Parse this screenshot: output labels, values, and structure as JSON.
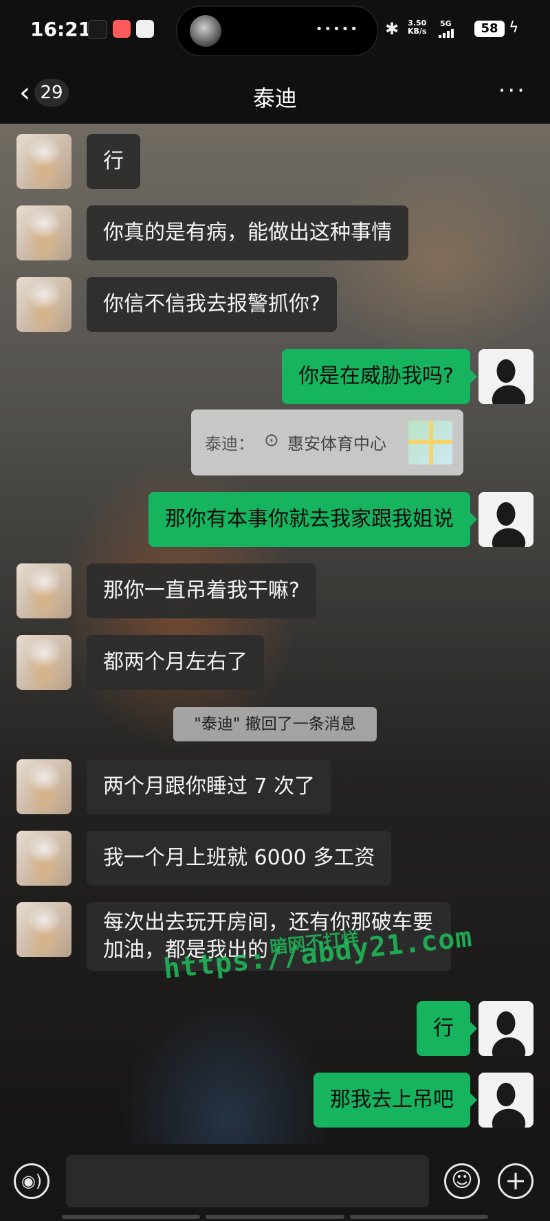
{
  "status_bar": {
    "time": "16:21",
    "net_speed_value": "3.50",
    "net_speed_unit": "KB/s",
    "network": "5G",
    "battery": "58",
    "bluetooth_icon": "bluetooth-icon",
    "charging_icon": "charging-bolt-icon"
  },
  "nav": {
    "back_icon": "chevron-left-icon",
    "unread_count": "29",
    "title": "泰迪",
    "more_icon": "more-dots-icon"
  },
  "messages": [
    {
      "side": "in",
      "text": "行"
    },
    {
      "side": "in",
      "text": "你真的是有病，能做出这种事情"
    },
    {
      "side": "in",
      "text": "你信不信我去报警抓你?"
    },
    {
      "side": "out",
      "text": "你是在威胁我吗?"
    },
    {
      "side": "out",
      "text": "那你有本事你就去我家跟我姐说"
    },
    {
      "side": "in",
      "text": "那你一直吊着我干嘛?"
    },
    {
      "side": "in",
      "text": "都两个月左右了"
    },
    {
      "side": "in",
      "text": "两个月跟你睡过 7 次了"
    },
    {
      "side": "in",
      "text": "我一个月上班就 6000 多工资"
    },
    {
      "side": "in",
      "text": "每次出去玩开房间，还有你那破车要加油，都是我出的"
    },
    {
      "side": "out",
      "text": "行"
    },
    {
      "side": "out",
      "text": "那我去上吊吧"
    }
  ],
  "location_share": {
    "sender": "泰迪：",
    "pin_icon": "location-pin-icon",
    "place": "惠安体育中心",
    "map_icon": "map-thumbnail-icon"
  },
  "recall_notice": "\"泰迪\" 撤回了一条消息",
  "watermark": {
    "url": "https://abdy21.com",
    "sub": "暗网不打烊"
  },
  "input_bar": {
    "voice_icon": "voice-icon",
    "emoji_icon": "emoji-icon",
    "plus_icon": "plus-icon",
    "placeholder": ""
  },
  "colors": {
    "outgoing_bubble": "#16b45f",
    "incoming_bubble": "#2d2d2d",
    "background": "#101010"
  }
}
